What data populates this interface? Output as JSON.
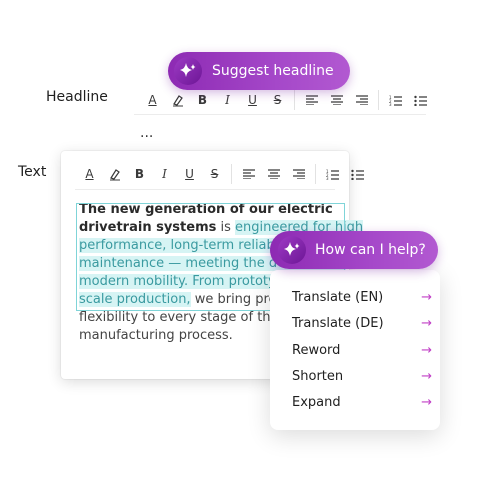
{
  "headline_field": {
    "label": "Headline",
    "value": "...",
    "toolbar": [
      "text-color",
      "highlight",
      "B",
      "I",
      "U",
      "S",
      "align-left",
      "align-center",
      "align-right",
      "ordered-list",
      "bullet-list"
    ]
  },
  "suggest_button": {
    "label": "Suggest headline"
  },
  "text_field": {
    "label": "Text",
    "toolbar_glyphs": {
      "text_color": "A",
      "bold": "B",
      "italic": "I",
      "underline": "U",
      "strike": "S"
    },
    "body": {
      "bold_lead": "The new generation of our electric drivetrain systems",
      "plain_1": " is ",
      "highlighted": "engineered for high performance, long-term reliability, reduced maintenance — meeting the demands of modern mobility. From prototyping to large-scale production,",
      "plain_2": " we bring precision and flexibility to every stage of the manufacturing process."
    }
  },
  "assistant": {
    "prompt_label": "How can I help?",
    "menu": [
      {
        "label": "Translate (EN)"
      },
      {
        "label": "Translate (DE)"
      },
      {
        "label": "Reword"
      },
      {
        "label": "Shorten"
      },
      {
        "label": "Expand"
      }
    ],
    "arrow": "→"
  },
  "colors": {
    "accent": "#a548c9",
    "highlight_bg": "#d6f4f4",
    "highlight_text": "#3a9aa0",
    "arrow": "#c03fc6"
  }
}
